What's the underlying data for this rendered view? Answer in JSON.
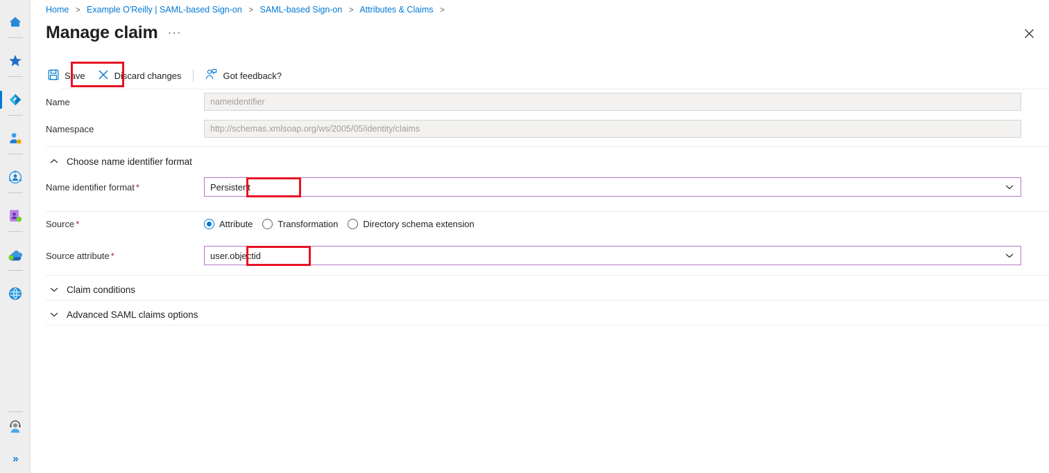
{
  "rail": {
    "items": [
      {
        "name": "home-icon",
        "label": "Home"
      },
      {
        "name": "favorites-star-icon",
        "label": "Favorites"
      },
      {
        "name": "azure-resource-icon",
        "label": "Enterprise applications",
        "active": true
      },
      {
        "name": "user-badge-icon",
        "label": "Users"
      },
      {
        "name": "identity-governance-icon",
        "label": "Identity Governance"
      },
      {
        "name": "groups-icon",
        "label": "Groups"
      },
      {
        "name": "cloud-services-icon",
        "label": "Cloud services"
      },
      {
        "name": "globe-icon",
        "label": "All resources"
      }
    ],
    "support_icon": "support-person-icon",
    "expand_label": "»"
  },
  "breadcrumb": {
    "items": [
      "Home",
      "Example O'Reilly | SAML-based Sign-on",
      "SAML-based Sign-on",
      "Attributes & Claims"
    ],
    "separator": ">"
  },
  "header": {
    "title": "Manage claim",
    "ellipsis": "···",
    "close_icon": "close-icon"
  },
  "toolbar": {
    "save_label": "Save",
    "save_icon": "save-floppy-icon",
    "discard_label": "Discard changes",
    "discard_icon": "close-x-icon",
    "feedback_label": "Got feedback?",
    "feedback_icon": "feedback-person-icon"
  },
  "form": {
    "name": {
      "label": "Name",
      "value": "nameidentifier",
      "disabled": true
    },
    "namespace": {
      "label": "Namespace",
      "value": "http://schemas.xmlsoap.org/ws/2005/05/identity/claims",
      "disabled": true
    },
    "name_id_section": {
      "label": "Choose name identifier format",
      "expanded": true,
      "chevron": "chevron-up-icon"
    },
    "name_id_format": {
      "label": "Name identifier format",
      "required": "*",
      "value": "Persistent",
      "chevron": "chevron-down-icon"
    },
    "source": {
      "label": "Source",
      "required": "*",
      "options": [
        {
          "label": "Attribute",
          "selected": true
        },
        {
          "label": "Transformation",
          "selected": false
        },
        {
          "label": "Directory schema extension",
          "selected": false
        }
      ]
    },
    "source_attribute": {
      "label": "Source attribute",
      "required": "*",
      "value": "user.objectid",
      "chevron": "chevron-down-icon"
    },
    "claim_conditions": {
      "label": "Claim conditions",
      "expanded": false,
      "chevron": "chevron-down-icon"
    },
    "advanced_options": {
      "label": "Advanced SAML claims options",
      "expanded": false,
      "chevron": "chevron-down-icon"
    }
  },
  "colors": {
    "accent": "#0078d4",
    "annotation": "#e81123",
    "dropdown_border": "#b673c9",
    "required": "#a4262c",
    "disabled_bg": "#f3f2f1"
  }
}
